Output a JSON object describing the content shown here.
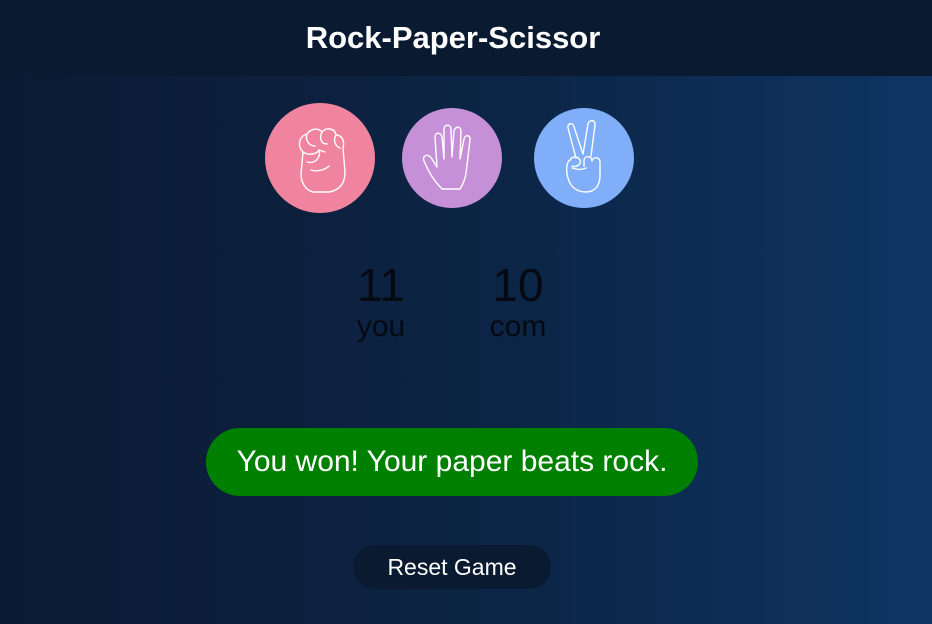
{
  "header": {
    "title": "Rock-Paper-Scissor"
  },
  "choices": [
    {
      "id": "rock",
      "icon": "fist-icon",
      "color": "#f0849f"
    },
    {
      "id": "paper",
      "icon": "open-hand-icon",
      "color": "#c590d8"
    },
    {
      "id": "scissor",
      "icon": "peace-sign-icon",
      "color": "#80aef8"
    }
  ],
  "scoreboard": {
    "user_score": "11",
    "user_label": "you",
    "computer_score": "10",
    "computer_label": "com"
  },
  "result": {
    "message": "You won! Your paper beats rock.",
    "color": "#008000"
  },
  "reset_button": {
    "label": "Reset Game"
  }
}
